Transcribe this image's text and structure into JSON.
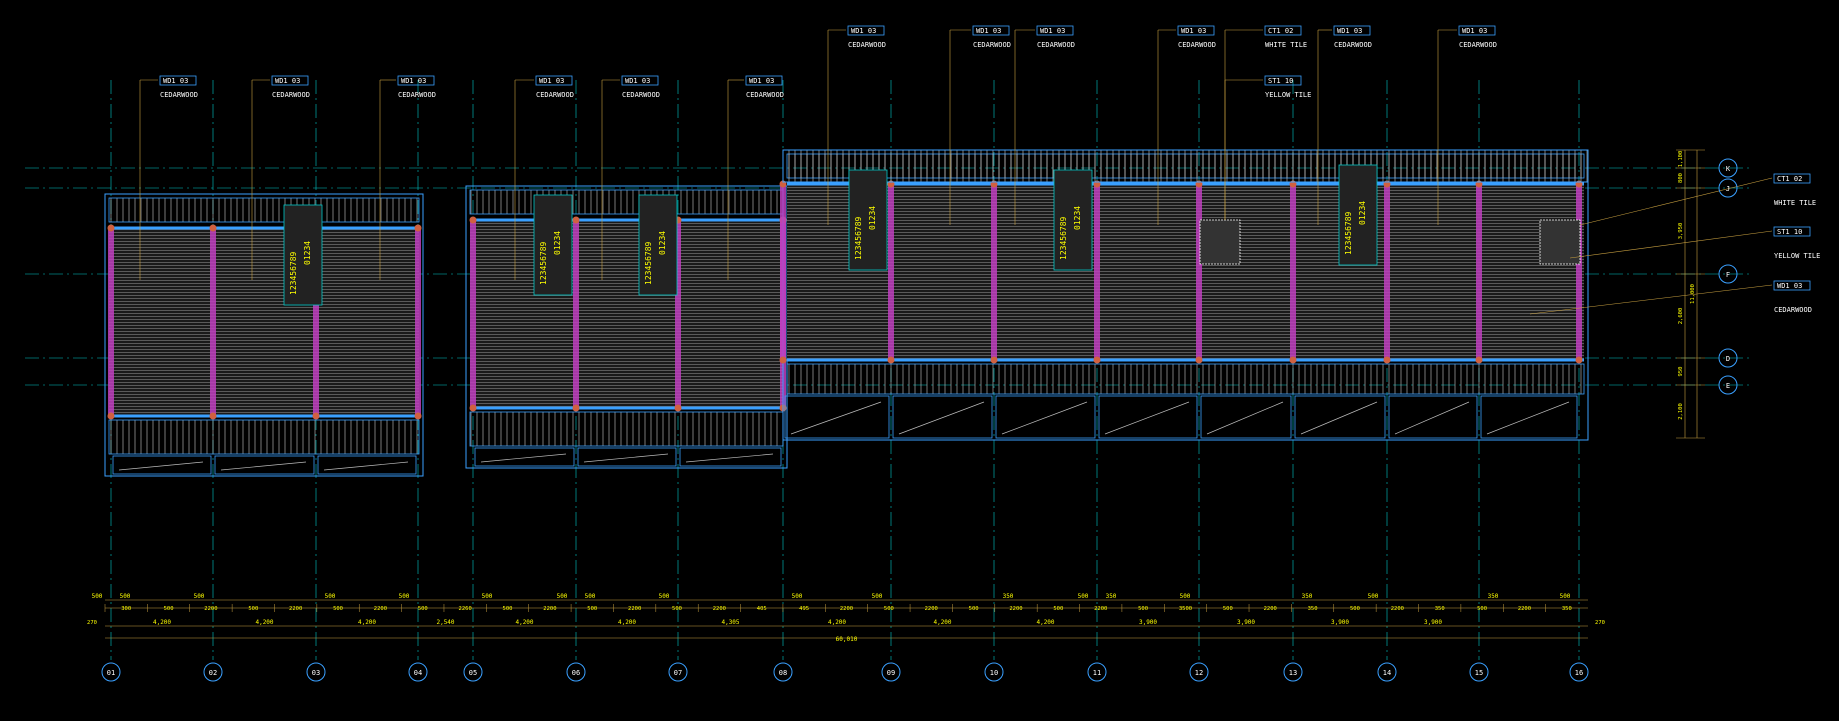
{
  "palette": {
    "background": "#000000",
    "gridline": "#00c8c8",
    "structure": "#3aa0ff",
    "tag": "#ffff00",
    "leader": "#c8a040",
    "column": "#c040c0",
    "text": "#ffffff",
    "fill": "#8a8a8a"
  },
  "grid_columns": [
    "01",
    "02",
    "03",
    "04",
    "05",
    "06",
    "07",
    "08",
    "09",
    "10",
    "11",
    "12",
    "13",
    "14",
    "15",
    "16"
  ],
  "grid_rows": [
    "K",
    "J",
    "F",
    "D",
    "E"
  ],
  "tags_top": [
    {
      "code": "WD1 03",
      "name": "CEDARWOOD"
    },
    {
      "code": "WD1 03",
      "name": "CEDARWOOD"
    },
    {
      "code": "WD1 03",
      "name": "CEDARWOOD"
    },
    {
      "code": "WD1 03",
      "name": "CEDARWOOD"
    },
    {
      "code": "WD1 03",
      "name": "CEDARWOOD"
    },
    {
      "code": "WD1 03",
      "name": "CEDARWOOD"
    },
    {
      "code": "WD1 03",
      "name": "CEDARWOOD"
    },
    {
      "code": "WD1 03",
      "name": "CEDARWOOD"
    },
    {
      "code": "WD1 03",
      "name": "CEDARWOOD"
    },
    {
      "code": "WD1 03",
      "name": "CEDARWOOD"
    },
    {
      "code": "CT1 02",
      "name": "WHITE TILE"
    },
    {
      "code": "ST1 10",
      "name": "YELLOW TILE"
    },
    {
      "code": "WD1 03",
      "name": "CEDARWOOD"
    },
    {
      "code": "WD1 03",
      "name": "CEDARWOOD"
    }
  ],
  "tags_right": [
    {
      "code": "CT1 02",
      "name": "WHITE TILE"
    },
    {
      "code": "ST1 10",
      "name": "YELLOW TILE"
    },
    {
      "code": "WD1 03",
      "name": "CEDARWOOD"
    }
  ],
  "dims_top_row": [
    "500",
    "500",
    "500",
    "500",
    "500",
    "500",
    "500",
    "500",
    "500",
    "500",
    "500",
    "350",
    "500",
    "350",
    "500",
    "350",
    "500",
    "350",
    "500"
  ],
  "dims_detail_row": [
    "300",
    "500",
    "2200",
    "500",
    "2200",
    "500",
    "2200",
    "500",
    "2260",
    "500",
    "2200",
    "500",
    "2200",
    "500",
    "2200",
    "405",
    "495",
    "2200",
    "500",
    "2200",
    "500",
    "2200",
    "500",
    "2200",
    "500",
    "3500",
    "500",
    "2200",
    "350",
    "500",
    "2200",
    "350",
    "500",
    "2200",
    "350"
  ],
  "dims_bay_row": [
    "4,200",
    "4,200",
    "4,200",
    "2,540",
    "4,200",
    "4,200",
    "4,305",
    "4,200",
    "4,200",
    "4,200",
    "3,900",
    "3,900",
    "3,900",
    "3,900"
  ],
  "dims_edge": [
    "270",
    "270"
  ],
  "dim_total": "60,010",
  "dims_right": [
    "1,100",
    "800",
    "3,950",
    "2,600",
    "950",
    "2,100",
    "11,000"
  ],
  "stair_numbers": "123456789",
  "stair_numbers_short": "01234"
}
